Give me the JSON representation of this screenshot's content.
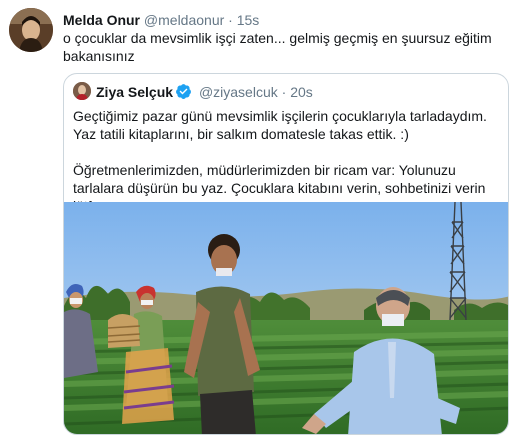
{
  "tweet": {
    "name": "Melda Onur",
    "handle": "@meldaonur",
    "separator": "·",
    "time": "15s",
    "text": "o çocuklar da mevsimlik işçi zaten... gelmiş geçmiş en şuursuz eğitim bakanısınız"
  },
  "quote": {
    "name": "Ziya Selçuk",
    "verified": true,
    "handle": "@ziyaselcuk",
    "separator": "·",
    "time": "20s",
    "paragraph1": "Geçtiğimiz pazar günü mevsimlik işçilerin çocuklarıyla tarladaydım. Yaz tatili kitaplarını, bir salkım domatesle takas ettik. :)",
    "paragraph2": "Öğretmenlerimizden, müdürlerimizden bir ricam var: Yolunuzu tarlalara düşürün bu yaz. Çocuklara kitabını verin, sohbetinizi verin lütfen..."
  },
  "colors": {
    "text": "#14171a",
    "secondary": "#657786",
    "border": "#ccd6dd",
    "verified": "#1da1f2"
  }
}
